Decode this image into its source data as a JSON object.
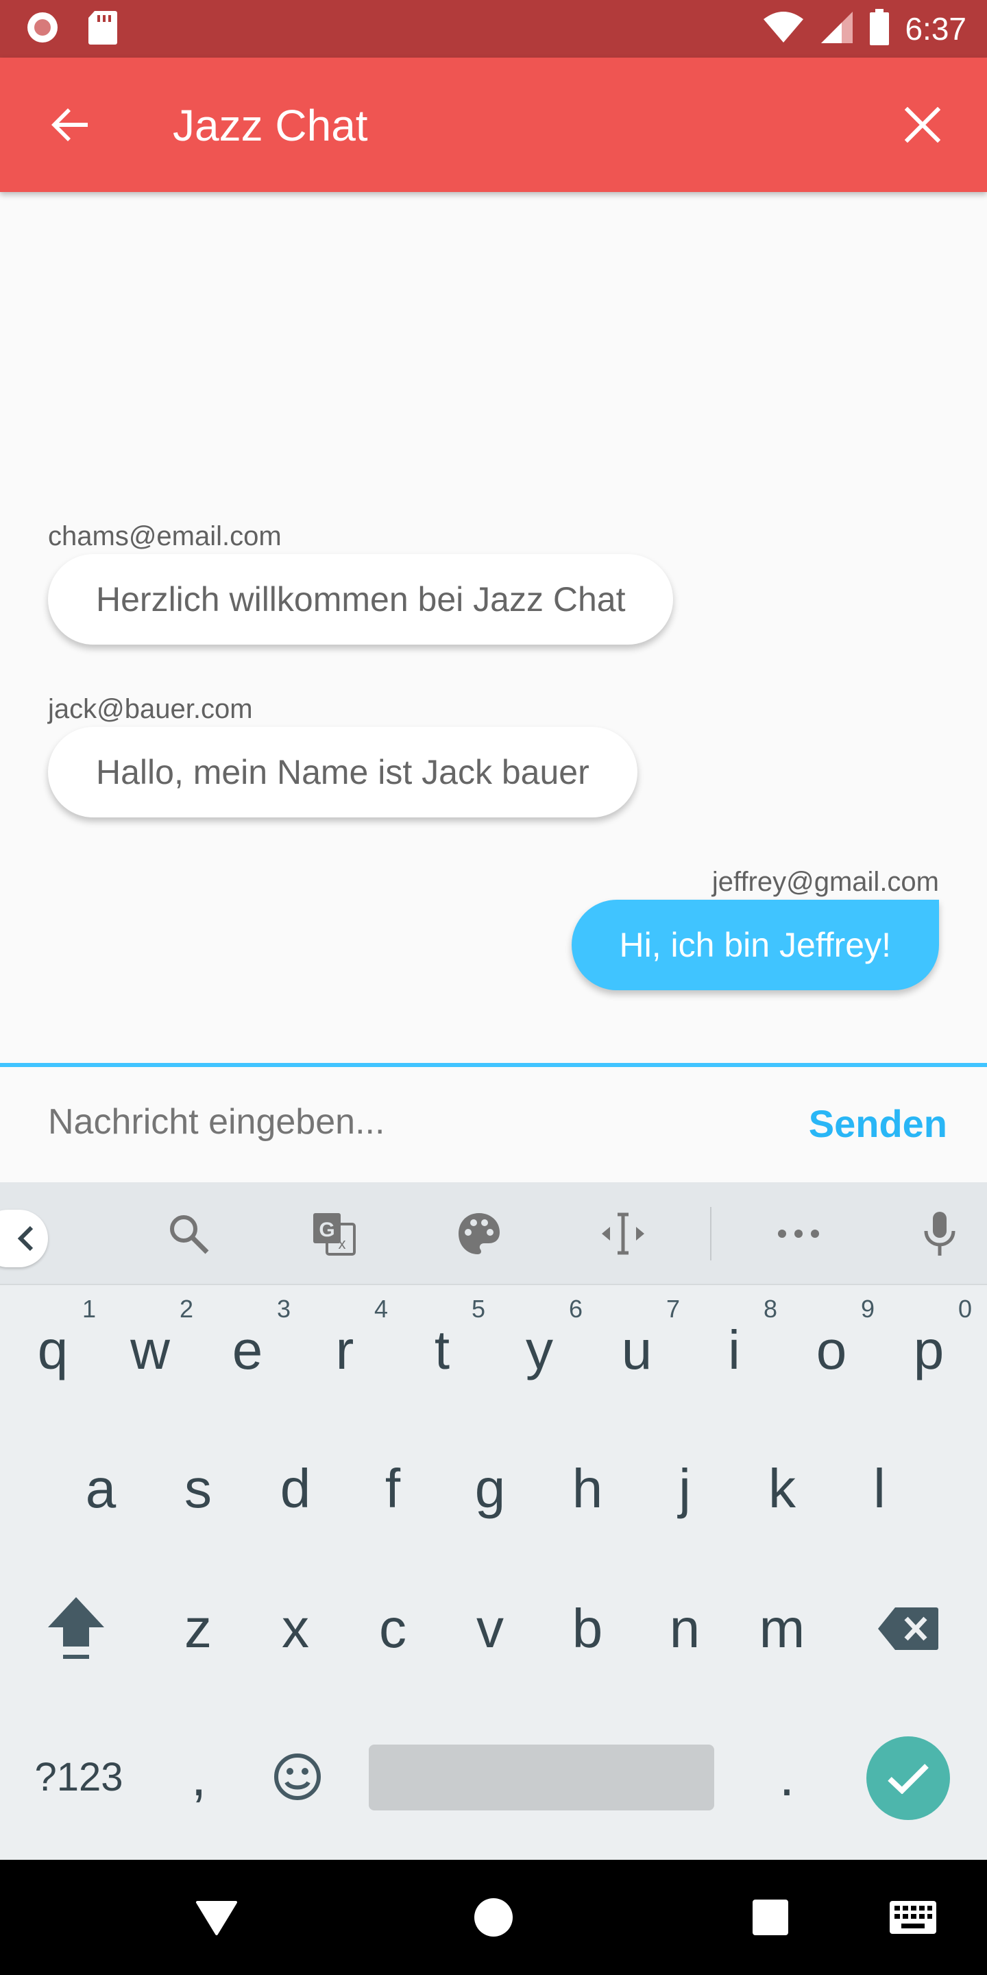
{
  "status_bar": {
    "time": "6:37"
  },
  "app_bar": {
    "title": "Jazz Chat"
  },
  "messages": [
    {
      "sender": "chams@email.com",
      "text": "Herzlich willkommen bei Jazz Chat"
    },
    {
      "sender": "jack@bauer.com",
      "text": "Hallo, mein Name ist Jack bauer"
    },
    {
      "sender": "jeffrey@gmail.com",
      "text": "Hi, ich bin Jeffrey!"
    }
  ],
  "composer": {
    "placeholder": "Nachricht eingeben...",
    "send_label": "Senden"
  },
  "keyboard": {
    "row1": [
      {
        "key": "q",
        "hint": "1"
      },
      {
        "key": "w",
        "hint": "2"
      },
      {
        "key": "e",
        "hint": "3"
      },
      {
        "key": "r",
        "hint": "4"
      },
      {
        "key": "t",
        "hint": "5"
      },
      {
        "key": "y",
        "hint": "6"
      },
      {
        "key": "u",
        "hint": "7"
      },
      {
        "key": "i",
        "hint": "8"
      },
      {
        "key": "o",
        "hint": "9"
      },
      {
        "key": "p",
        "hint": "0"
      }
    ],
    "row2": [
      "a",
      "s",
      "d",
      "f",
      "g",
      "h",
      "j",
      "k",
      "l"
    ],
    "row3": [
      "z",
      "x",
      "c",
      "v",
      "b",
      "n",
      "m"
    ],
    "symbols_key": "?123",
    "comma_key": ",",
    "period_key": "."
  },
  "colors": {
    "status_bar": "#b23b3b",
    "app_bar": "#ef5552",
    "accent": "#40c4ff",
    "enter_key": "#4db6ac"
  }
}
